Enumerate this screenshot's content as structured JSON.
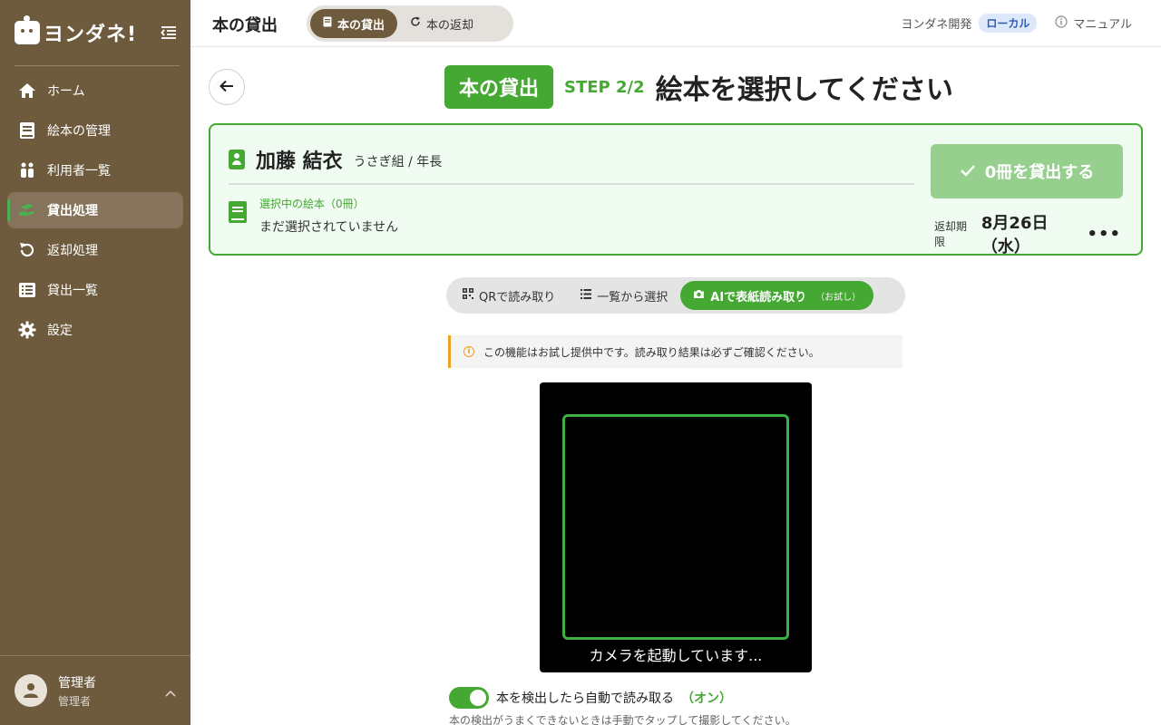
{
  "sidebar": {
    "logo_text": "ヨンダネ!",
    "nav": [
      {
        "label": "ホーム"
      },
      {
        "label": "絵本の管理"
      },
      {
        "label": "利用者一覧"
      },
      {
        "label": "貸出処理"
      },
      {
        "label": "返却処理"
      },
      {
        "label": "貸出一覧"
      },
      {
        "label": "設定"
      }
    ],
    "active_index": 3,
    "user": {
      "name": "管理者",
      "role": "管理者"
    }
  },
  "header": {
    "title": "本の貸出",
    "segments": [
      {
        "label": "本の貸出"
      },
      {
        "label": "本の返却"
      }
    ],
    "org": "ヨンダネ開発",
    "env_badge": "ローカル",
    "manual": "マニュアル"
  },
  "title_row": {
    "mode_badge": "本の貸出",
    "step": "STEP 2/2",
    "title": "絵本を選択してください"
  },
  "card": {
    "name": "加藤 結衣",
    "class": "うさぎ組 / 年長",
    "selected_label": "選択中の絵本（0冊）",
    "selected_empty": "まだ選択されていません",
    "lend_button": "0冊を貸出する",
    "due_label": "返却期限",
    "due_date": "8月26日（水）",
    "more": "•••"
  },
  "modes": [
    {
      "label": "QRで読み取り"
    },
    {
      "label": "一覧から選択"
    },
    {
      "label": "AIで表紙読み取り",
      "note": "（お試し）"
    }
  ],
  "notice": "この機能はお試し提供中です。読み取り結果は必ずご確認ください。",
  "camera": {
    "status": "カメラを起動しています..."
  },
  "auto_read": {
    "label": "本を検出したら自動で読み取る",
    "state": "（オン）",
    "hint": "本の検出がうまくできないときは手動でタップして撮影してください。"
  },
  "colors": {
    "sidebar": "#6e5a3c",
    "accent_green": "#44a832",
    "badge_blue": "#2d5bb5"
  }
}
